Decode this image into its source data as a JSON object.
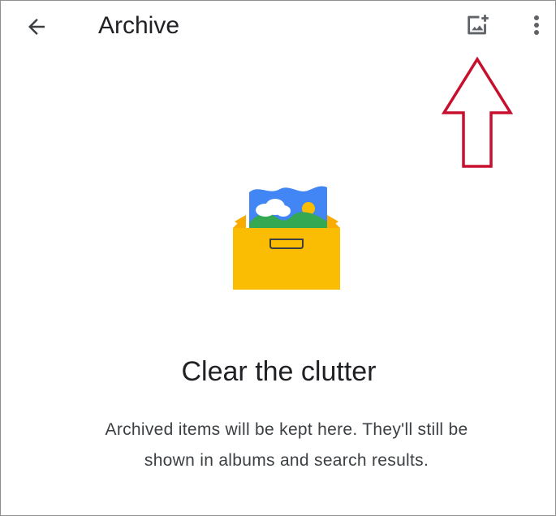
{
  "app_bar": {
    "title": "Archive",
    "back_icon": "arrow-back-icon",
    "add_photo_icon": "add-photo-icon",
    "more_icon": "more-vert-icon"
  },
  "empty_state": {
    "illustration_icon": "archive-box-illustration",
    "heading": "Clear the clutter",
    "body": "Archived items will be kept here. They'll still be shown in albums and search results."
  },
  "annotation": {
    "arrow_icon": "up-arrow-annotation",
    "arrow_color": "#c8102e"
  },
  "colors": {
    "box_yellow": "#fbbc04",
    "photo_blue": "#4285f4",
    "photo_green": "#34a853",
    "sun_yellow": "#fbbc04",
    "text_primary": "#202124",
    "text_secondary": "#3c4043"
  }
}
